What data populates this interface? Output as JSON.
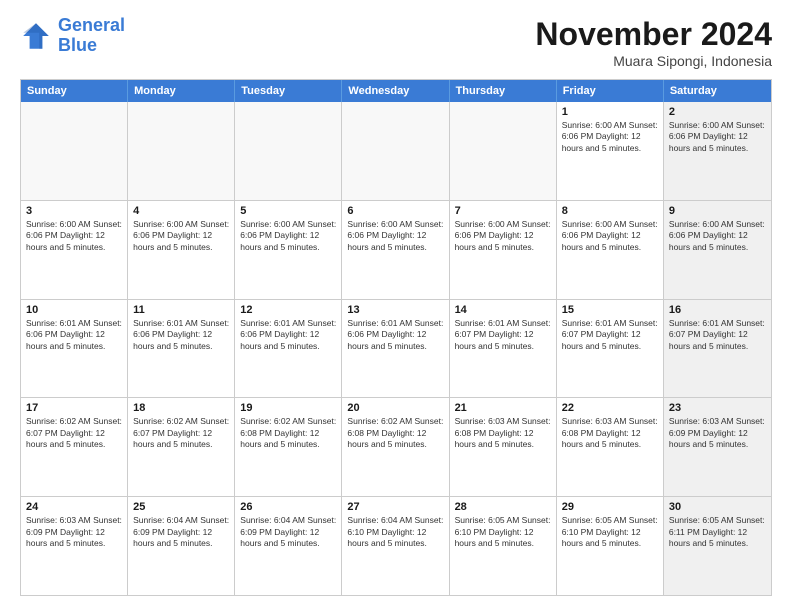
{
  "logo": {
    "line1": "General",
    "line2": "Blue"
  },
  "title": "November 2024",
  "subtitle": "Muara Sipongi, Indonesia",
  "headers": [
    "Sunday",
    "Monday",
    "Tuesday",
    "Wednesday",
    "Thursday",
    "Friday",
    "Saturday"
  ],
  "rows": [
    [
      {
        "day": "",
        "info": "",
        "empty": true
      },
      {
        "day": "",
        "info": "",
        "empty": true
      },
      {
        "day": "",
        "info": "",
        "empty": true
      },
      {
        "day": "",
        "info": "",
        "empty": true
      },
      {
        "day": "",
        "info": "",
        "empty": true
      },
      {
        "day": "1",
        "info": "Sunrise: 6:00 AM\nSunset: 6:06 PM\nDaylight: 12 hours\nand 5 minutes.",
        "empty": false
      },
      {
        "day": "2",
        "info": "Sunrise: 6:00 AM\nSunset: 6:06 PM\nDaylight: 12 hours\nand 5 minutes.",
        "empty": false,
        "shaded": true
      }
    ],
    [
      {
        "day": "3",
        "info": "Sunrise: 6:00 AM\nSunset: 6:06 PM\nDaylight: 12 hours\nand 5 minutes.",
        "empty": false
      },
      {
        "day": "4",
        "info": "Sunrise: 6:00 AM\nSunset: 6:06 PM\nDaylight: 12 hours\nand 5 minutes.",
        "empty": false
      },
      {
        "day": "5",
        "info": "Sunrise: 6:00 AM\nSunset: 6:06 PM\nDaylight: 12 hours\nand 5 minutes.",
        "empty": false
      },
      {
        "day": "6",
        "info": "Sunrise: 6:00 AM\nSunset: 6:06 PM\nDaylight: 12 hours\nand 5 minutes.",
        "empty": false
      },
      {
        "day": "7",
        "info": "Sunrise: 6:00 AM\nSunset: 6:06 PM\nDaylight: 12 hours\nand 5 minutes.",
        "empty": false
      },
      {
        "day": "8",
        "info": "Sunrise: 6:00 AM\nSunset: 6:06 PM\nDaylight: 12 hours\nand 5 minutes.",
        "empty": false
      },
      {
        "day": "9",
        "info": "Sunrise: 6:00 AM\nSunset: 6:06 PM\nDaylight: 12 hours\nand 5 minutes.",
        "empty": false,
        "shaded": true
      }
    ],
    [
      {
        "day": "10",
        "info": "Sunrise: 6:01 AM\nSunset: 6:06 PM\nDaylight: 12 hours\nand 5 minutes.",
        "empty": false
      },
      {
        "day": "11",
        "info": "Sunrise: 6:01 AM\nSunset: 6:06 PM\nDaylight: 12 hours\nand 5 minutes.",
        "empty": false
      },
      {
        "day": "12",
        "info": "Sunrise: 6:01 AM\nSunset: 6:06 PM\nDaylight: 12 hours\nand 5 minutes.",
        "empty": false
      },
      {
        "day": "13",
        "info": "Sunrise: 6:01 AM\nSunset: 6:06 PM\nDaylight: 12 hours\nand 5 minutes.",
        "empty": false
      },
      {
        "day": "14",
        "info": "Sunrise: 6:01 AM\nSunset: 6:07 PM\nDaylight: 12 hours\nand 5 minutes.",
        "empty": false
      },
      {
        "day": "15",
        "info": "Sunrise: 6:01 AM\nSunset: 6:07 PM\nDaylight: 12 hours\nand 5 minutes.",
        "empty": false
      },
      {
        "day": "16",
        "info": "Sunrise: 6:01 AM\nSunset: 6:07 PM\nDaylight: 12 hours\nand 5 minutes.",
        "empty": false,
        "shaded": true
      }
    ],
    [
      {
        "day": "17",
        "info": "Sunrise: 6:02 AM\nSunset: 6:07 PM\nDaylight: 12 hours\nand 5 minutes.",
        "empty": false
      },
      {
        "day": "18",
        "info": "Sunrise: 6:02 AM\nSunset: 6:07 PM\nDaylight: 12 hours\nand 5 minutes.",
        "empty": false
      },
      {
        "day": "19",
        "info": "Sunrise: 6:02 AM\nSunset: 6:08 PM\nDaylight: 12 hours\nand 5 minutes.",
        "empty": false
      },
      {
        "day": "20",
        "info": "Sunrise: 6:02 AM\nSunset: 6:08 PM\nDaylight: 12 hours\nand 5 minutes.",
        "empty": false
      },
      {
        "day": "21",
        "info": "Sunrise: 6:03 AM\nSunset: 6:08 PM\nDaylight: 12 hours\nand 5 minutes.",
        "empty": false
      },
      {
        "day": "22",
        "info": "Sunrise: 6:03 AM\nSunset: 6:08 PM\nDaylight: 12 hours\nand 5 minutes.",
        "empty": false
      },
      {
        "day": "23",
        "info": "Sunrise: 6:03 AM\nSunset: 6:09 PM\nDaylight: 12 hours\nand 5 minutes.",
        "empty": false,
        "shaded": true
      }
    ],
    [
      {
        "day": "24",
        "info": "Sunrise: 6:03 AM\nSunset: 6:09 PM\nDaylight: 12 hours\nand 5 minutes.",
        "empty": false
      },
      {
        "day": "25",
        "info": "Sunrise: 6:04 AM\nSunset: 6:09 PM\nDaylight: 12 hours\nand 5 minutes.",
        "empty": false
      },
      {
        "day": "26",
        "info": "Sunrise: 6:04 AM\nSunset: 6:09 PM\nDaylight: 12 hours\nand 5 minutes.",
        "empty": false
      },
      {
        "day": "27",
        "info": "Sunrise: 6:04 AM\nSunset: 6:10 PM\nDaylight: 12 hours\nand 5 minutes.",
        "empty": false
      },
      {
        "day": "28",
        "info": "Sunrise: 6:05 AM\nSunset: 6:10 PM\nDaylight: 12 hours\nand 5 minutes.",
        "empty": false
      },
      {
        "day": "29",
        "info": "Sunrise: 6:05 AM\nSunset: 6:10 PM\nDaylight: 12 hours\nand 5 minutes.",
        "empty": false
      },
      {
        "day": "30",
        "info": "Sunrise: 6:05 AM\nSunset: 6:11 PM\nDaylight: 12 hours\nand 5 minutes.",
        "empty": false,
        "shaded": true
      }
    ]
  ]
}
